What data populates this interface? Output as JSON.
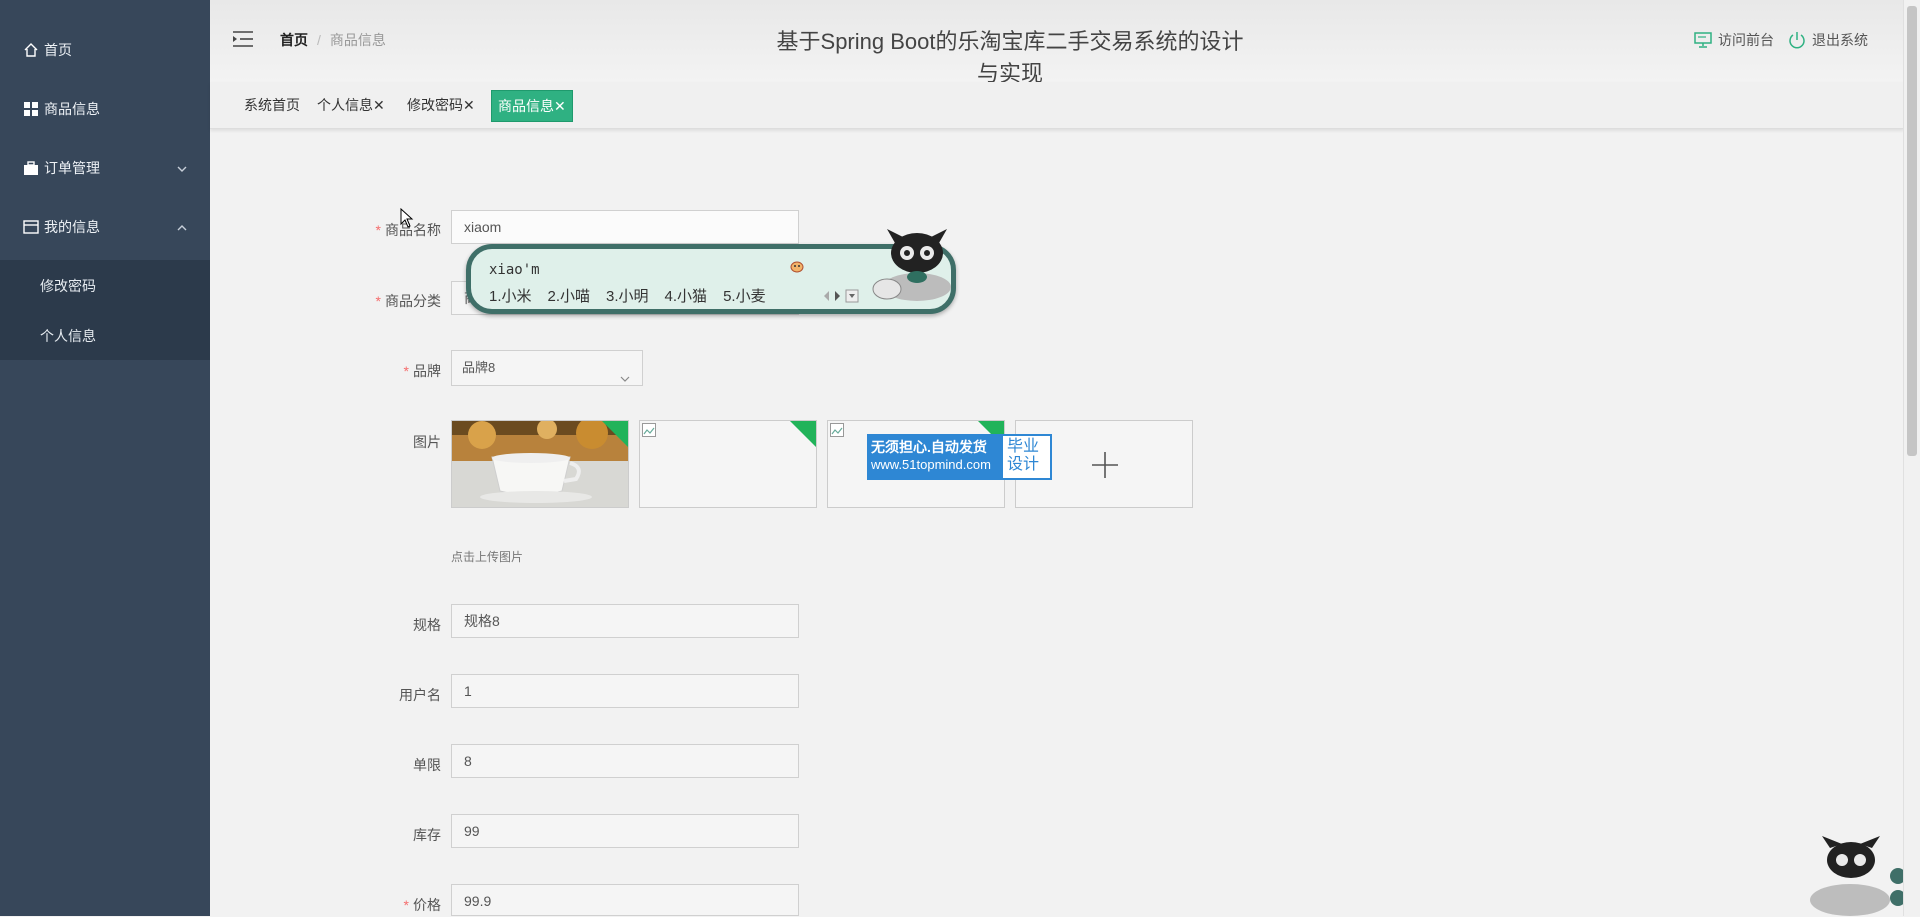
{
  "sidebar": {
    "items": [
      {
        "label": "首页",
        "icon": "home-icon"
      },
      {
        "label": "商品信息",
        "icon": "grid-icon"
      },
      {
        "label": "订单管理",
        "icon": "briefcase-icon"
      },
      {
        "label": "我的信息",
        "icon": "card-icon"
      }
    ],
    "submenu": [
      "修改密码",
      "个人信息"
    ]
  },
  "header": {
    "breadcrumb_home": "首页",
    "breadcrumb_sep": "/",
    "breadcrumb_current": "商品信息",
    "title": "基于Spring Boot的乐淘宝库二手交易系统的设计与实现",
    "visit_front": "访问前台",
    "logout": "退出系统"
  },
  "tabs": [
    {
      "label": "系统首页"
    },
    {
      "label": "个人信息✕"
    },
    {
      "label": "修改密码✕"
    },
    {
      "label": "商品信息✕",
      "active": true
    }
  ],
  "form": {
    "name_label": "商品名称",
    "name_value": "xiaom",
    "category_label": "商品分类",
    "category_value": "商",
    "brand_label": "品牌",
    "brand_value": "品牌8",
    "image_label": "图片",
    "upload_hint": "点击上传图片",
    "spec_label": "规格",
    "spec_value": "规格8",
    "user_label": "用户名",
    "user_value": "1",
    "limit_label": "单限",
    "limit_value": "8",
    "stock_label": "库存",
    "stock_value": "99",
    "price_label": "价格",
    "price_value": "99.9",
    "required_mark": "*"
  },
  "ime": {
    "input": "xiao'm",
    "candidates": [
      "1.小米",
      "2.小喵",
      "3.小明",
      "4.小猫",
      "5.小麦"
    ]
  },
  "watermark": {
    "line1": "无须担心.自动发货",
    "url": "www.51topmind.com",
    "right": "毕业设计"
  },
  "colors": {
    "sidebar": "#37475a",
    "active_tab": "#2fb182",
    "required": "#f56c6c"
  }
}
